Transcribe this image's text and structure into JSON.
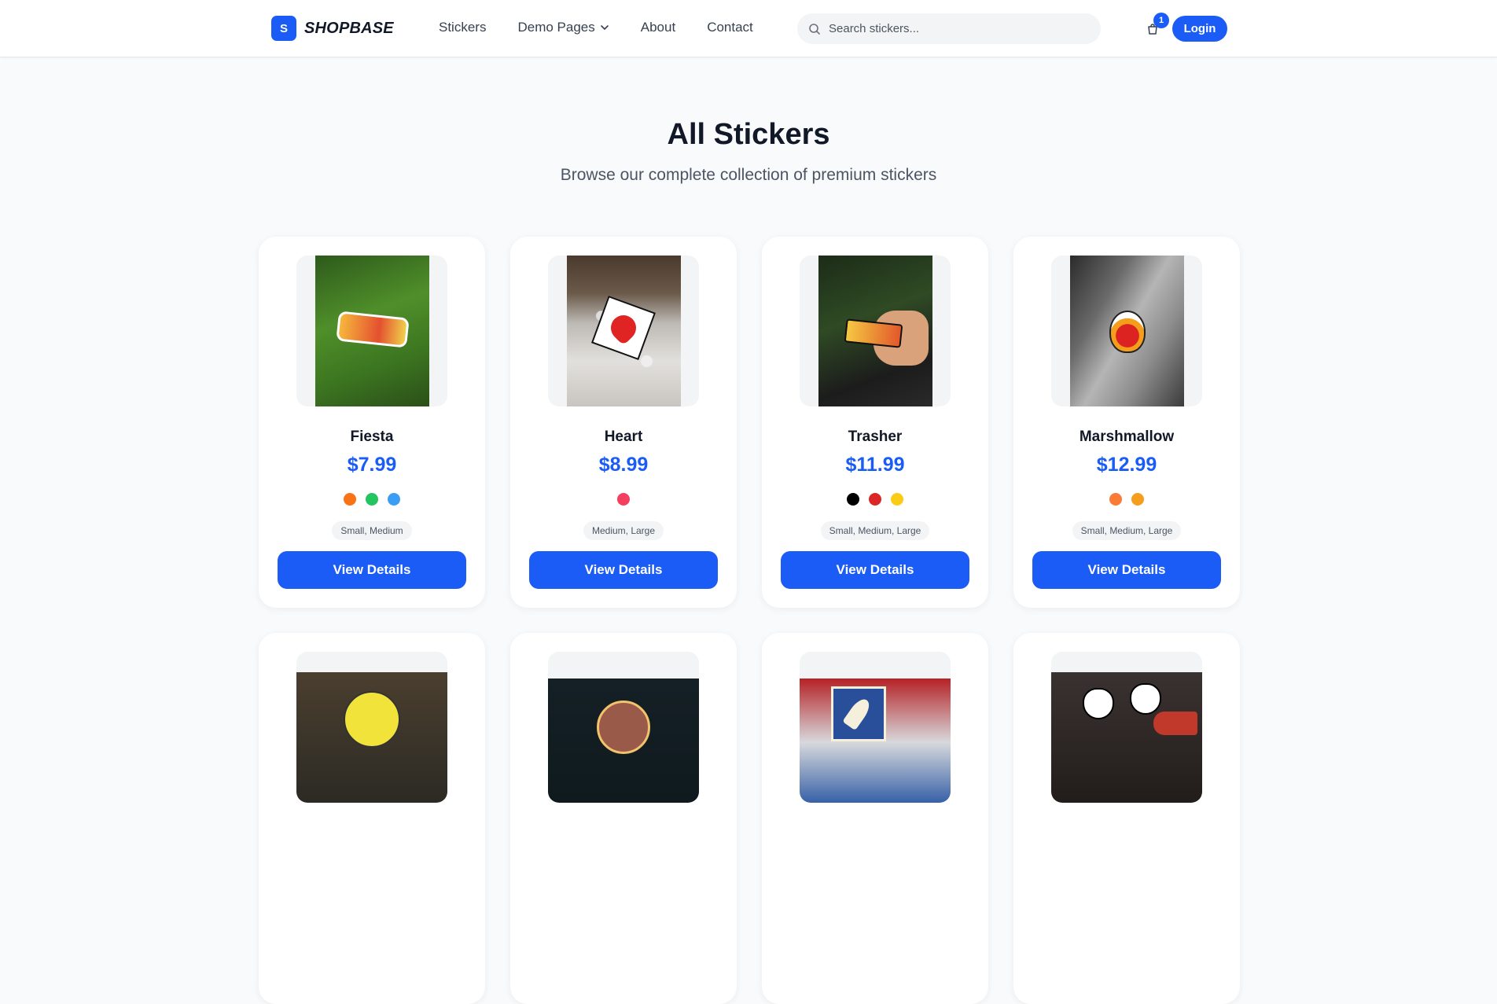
{
  "header": {
    "logo_letter": "S",
    "brand": "SHOPBASE",
    "nav": [
      "Stickers",
      "Demo Pages",
      "About",
      "Contact"
    ],
    "search_placeholder": "Search stickers...",
    "cart_count": "1",
    "login_label": "Login"
  },
  "hero": {
    "title": "All Stickers",
    "subtitle": "Browse our complete collection of premium stickers"
  },
  "products": [
    {
      "name": "Fiesta",
      "price": "$7.99",
      "colors": [
        "#f97316",
        "#22c55e",
        "#3b9ef5"
      ],
      "sizes": "Small, Medium",
      "button": "View Details"
    },
    {
      "name": "Heart",
      "price": "$8.99",
      "colors": [
        "#f43f5e"
      ],
      "sizes": "Medium, Large",
      "button": "View Details"
    },
    {
      "name": "Trasher",
      "price": "$11.99",
      "colors": [
        "#000000",
        "#dc2626",
        "#facc15"
      ],
      "sizes": "Small, Medium, Large",
      "button": "View Details"
    },
    {
      "name": "Marshmallow",
      "price": "$12.99",
      "colors": [
        "#fb7a35",
        "#f59e1b"
      ],
      "sizes": "Small, Medium, Large",
      "button": "View Details"
    }
  ],
  "accent_color": "#1a5cf5"
}
